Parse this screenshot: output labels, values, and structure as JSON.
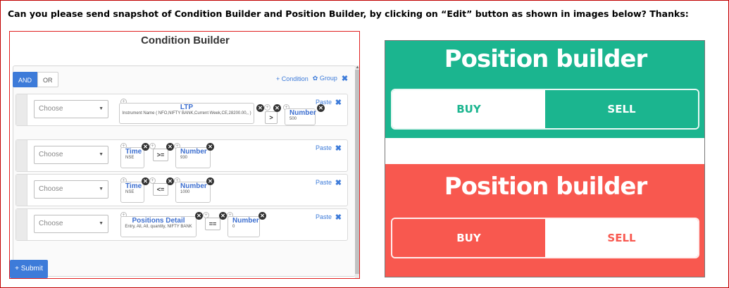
{
  "question": "Can you please send snapshot of Condition Builder and Position Builder, by clicking on “Edit” button as shown in images below? Thanks:",
  "condition_builder": {
    "title": "Condition Builder",
    "and_label": "AND",
    "or_label": "OR",
    "add_condition": "+ Condition",
    "add_group": "✿ Group",
    "remove": "✖",
    "submit": "+ Submit",
    "rules": [
      {
        "choose": "Choose",
        "paste": "Paste",
        "operand1_title": "LTP",
        "operand1_sub": "Instrument Name ( NFO,NIFTY BANK,Current Week,CE,28200.00,, )",
        "operator": ">",
        "operand2_title": "Number",
        "operand2_sub": "500"
      },
      {
        "choose": "Choose",
        "paste": "Paste",
        "operand1_title": "Time",
        "operand1_sub": "NSE",
        "operator": ">=",
        "operand2_title": "Number",
        "operand2_sub": "930"
      },
      {
        "choose": "Choose",
        "paste": "Paste",
        "operand1_title": "Time",
        "operand1_sub": "NSE",
        "operator": "<=",
        "operand2_title": "Number",
        "operand2_sub": "1000"
      },
      {
        "choose": "Choose",
        "paste": "Paste",
        "operand1_title": "Positions Detail",
        "operand1_sub": "Entry, All, All, quantity, NIFTY BANK",
        "operator": "==",
        "operand2_title": "Number",
        "operand2_sub": "0"
      }
    ]
  },
  "position_builder": {
    "green": {
      "title": "Position builder",
      "buy": "BUY",
      "sell": "SELL",
      "color": "#1bb58f"
    },
    "red": {
      "title": "Position builder",
      "buy": "BUY",
      "sell": "SELL",
      "color": "#f8584f"
    }
  },
  "colors": {
    "accent": "#3d7bd9",
    "frame": "#c00000"
  }
}
